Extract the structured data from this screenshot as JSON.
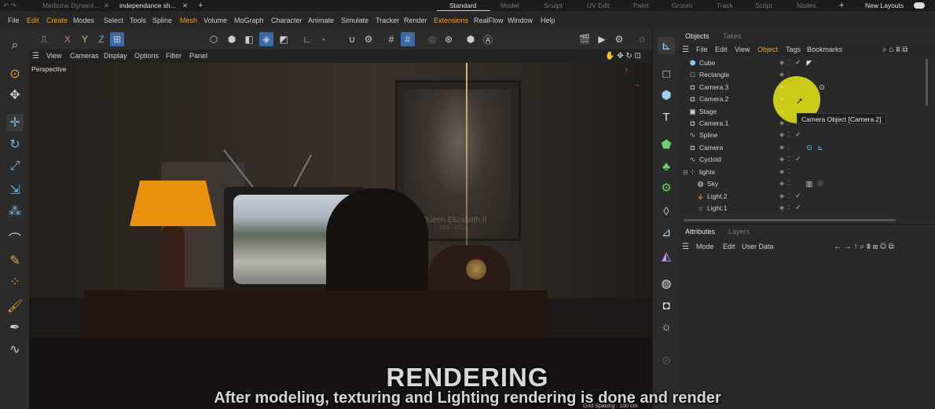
{
  "top_tabs": {
    "docs": [
      {
        "label": "Medicine Dynami..."
      },
      {
        "label": "independance sh..."
      }
    ],
    "add": "+",
    "close": "✕",
    "layouts": [
      "Standard",
      "Model",
      "Sculpt",
      "UV Edit",
      "Paint",
      "Groom",
      "Track",
      "Script",
      "Nodes"
    ],
    "new_layouts": "New Layouts"
  },
  "menu": [
    "File",
    "Edit",
    "Create",
    "Modes",
    "Select",
    "Tools",
    "Spline",
    "Mesh",
    "Volume",
    "MoGraph",
    "Character",
    "Animate",
    "Simulate",
    "Tracker",
    "Render",
    "Extensions",
    "RealFlow",
    "Window",
    "Help"
  ],
  "viewport": {
    "menu": [
      "View",
      "Cameras",
      "Display",
      "Options",
      "Filter",
      "Panel"
    ],
    "label": "Perspective",
    "poster_caption": "Queen Elizabeth II",
    "poster_years": "1926 - 2022",
    "grid_spacing": "Grid Spacing : 100 cm"
  },
  "objects_panel": {
    "tabs": [
      "Objects",
      "Takes"
    ],
    "menu": [
      "File",
      "Edit",
      "View",
      "Object",
      "Tags",
      "Bookmarks"
    ],
    "rows": [
      {
        "name": "Cube",
        "icon": "cube-icon"
      },
      {
        "name": "Rectangle",
        "icon": "rectangle-icon"
      },
      {
        "name": "Camera.3",
        "icon": "camera-icon"
      },
      {
        "name": "Camera.2",
        "icon": "camera-icon"
      },
      {
        "name": "Stage",
        "icon": "stage-icon"
      },
      {
        "name": "Camera.1",
        "icon": "camera-icon"
      },
      {
        "name": "Spline",
        "icon": "spline-icon"
      },
      {
        "name": "Camera",
        "icon": "camera-icon"
      },
      {
        "name": "Cycloid",
        "icon": "cycloid-icon"
      },
      {
        "name": "lights",
        "icon": "null-icon"
      },
      {
        "name": "Sky",
        "icon": "sky-icon"
      },
      {
        "name": "Light.2",
        "icon": "light-icon"
      },
      {
        "name": "Light.1",
        "icon": "light-icon"
      }
    ],
    "tooltip": "Camera Object [Camera.2]"
  },
  "attributes_panel": {
    "tabs": [
      "Attributes",
      "Layers"
    ],
    "menu": [
      "Mode",
      "Edit",
      "User Data"
    ]
  },
  "captions": {
    "title": "RENDERING",
    "subtitle": "After modeling, texturing and Lighting rendering is done and render"
  },
  "colors": {
    "accent_orange": "#f0a030",
    "icon_blue": "#8cc8ee",
    "highlight_yellow": "#e6e614"
  }
}
